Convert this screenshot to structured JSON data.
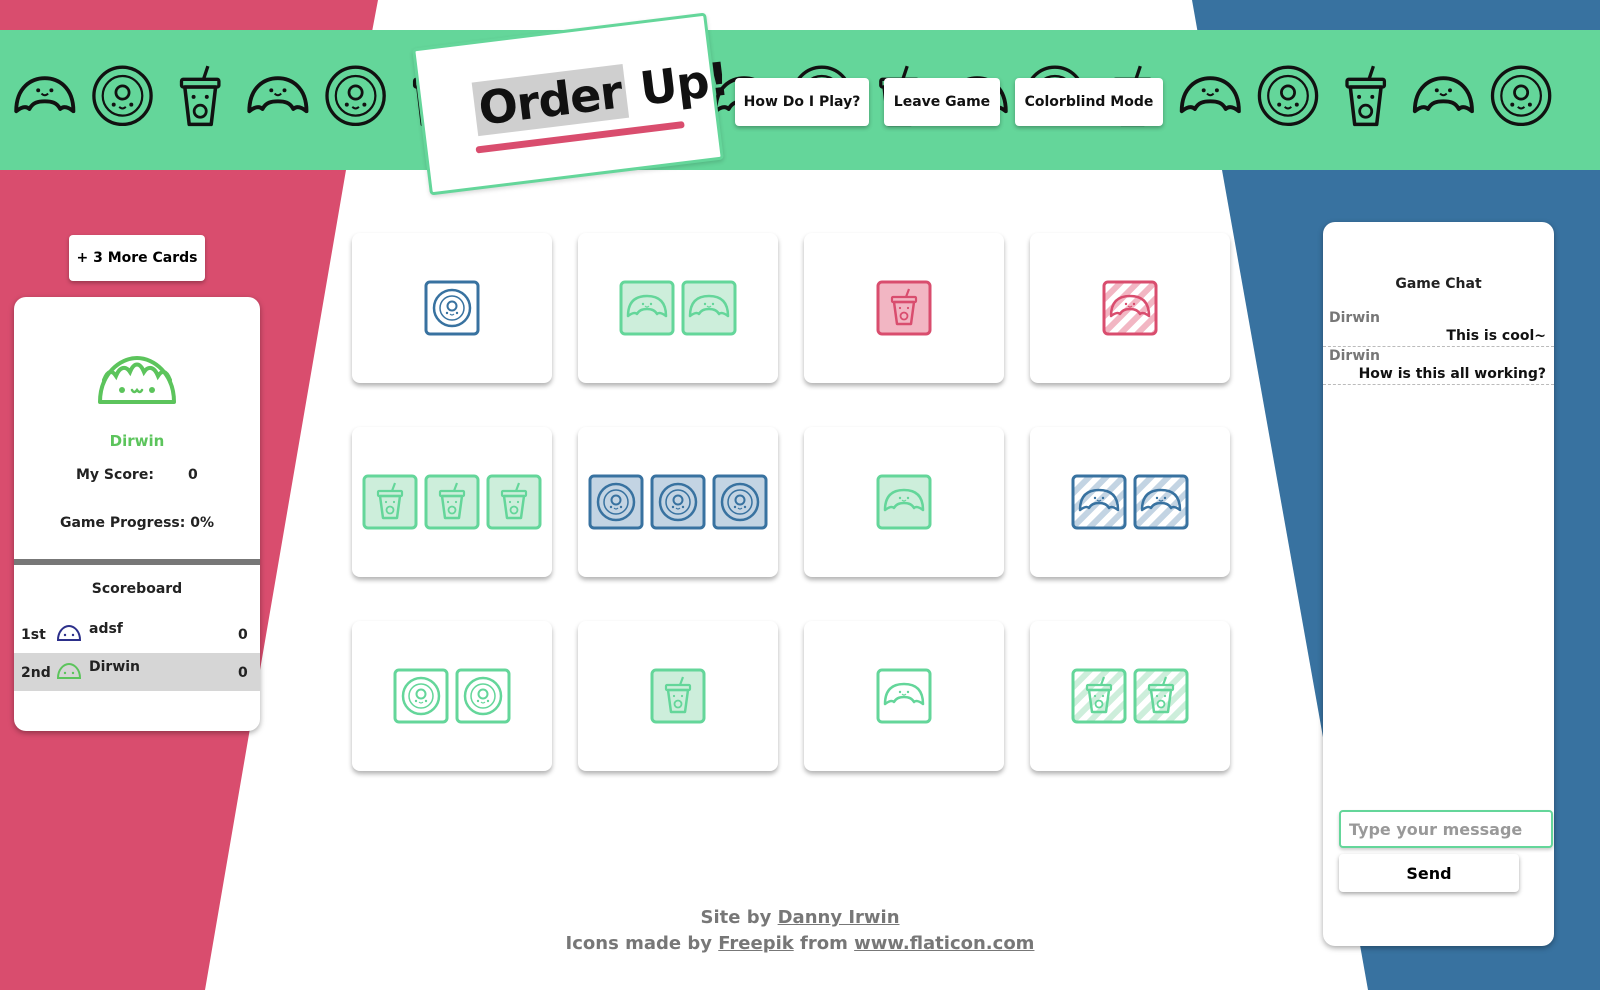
{
  "colors": {
    "red": "#d94d6e",
    "green": "#64d69a",
    "blue": "#3872a0",
    "player_green": "#5cc45c"
  },
  "header": {
    "logo_part1": "Order",
    "logo_part2": "Up!",
    "icons": [
      "croissant-icon",
      "donut-icon",
      "coffee-cup-icon"
    ],
    "buttons": {
      "how_to_play": "How Do I Play?",
      "leave_game": "Leave Game",
      "colorblind_mode": "Colorblind Mode"
    }
  },
  "left_panel": {
    "more_cards_button": "+ 3 More Cards",
    "player": {
      "avatar_icon": "taco-icon",
      "name": "Dirwin",
      "score_label": "My Score:",
      "score": "0",
      "progress_label": "Game Progress: 0%"
    },
    "scoreboard": {
      "title": "Scoreboard",
      "rows": [
        {
          "rank": "1st",
          "avatar_icon": "taco-icon",
          "avatar_color": "#2c2f8a",
          "name": "adsf",
          "score": "0"
        },
        {
          "rank": "2nd",
          "avatar_icon": "taco-icon",
          "avatar_color": "#5cc45c",
          "name": "Dirwin",
          "score": "0"
        }
      ]
    }
  },
  "board": {
    "cards": [
      {
        "shape": "donut",
        "color": "blue",
        "fill": "outline",
        "count": 1
      },
      {
        "shape": "croissant",
        "color": "green",
        "fill": "solid",
        "count": 2
      },
      {
        "shape": "cup",
        "color": "red",
        "fill": "solid",
        "count": 1
      },
      {
        "shape": "croissant",
        "color": "red",
        "fill": "striped",
        "count": 1
      },
      {
        "shape": "cup",
        "color": "green",
        "fill": "solid",
        "count": 3
      },
      {
        "shape": "donut",
        "color": "blue",
        "fill": "solid",
        "count": 3
      },
      {
        "shape": "croissant",
        "color": "green",
        "fill": "solid",
        "count": 1
      },
      {
        "shape": "croissant",
        "color": "blue",
        "fill": "striped",
        "count": 2
      },
      {
        "shape": "donut",
        "color": "green",
        "fill": "outline",
        "count": 2
      },
      {
        "shape": "cup",
        "color": "green",
        "fill": "solid",
        "count": 1
      },
      {
        "shape": "croissant",
        "color": "green",
        "fill": "outline",
        "count": 1
      },
      {
        "shape": "cup",
        "color": "green",
        "fill": "striped",
        "count": 2
      }
    ]
  },
  "chat": {
    "title": "Game Chat",
    "messages": [
      {
        "author": "Dirwin",
        "text": "This is cool~"
      },
      {
        "author": "Dirwin",
        "text": "How is this all working?"
      }
    ],
    "input_placeholder": "Type your message",
    "send_label": "Send"
  },
  "footer": {
    "site_by": "Site by",
    "author_link": "Danny Irwin",
    "icons_made_by": "Icons made by",
    "freepik_link": "Freepik",
    "from": "from",
    "flaticon_link": "www.flaticon.com"
  }
}
